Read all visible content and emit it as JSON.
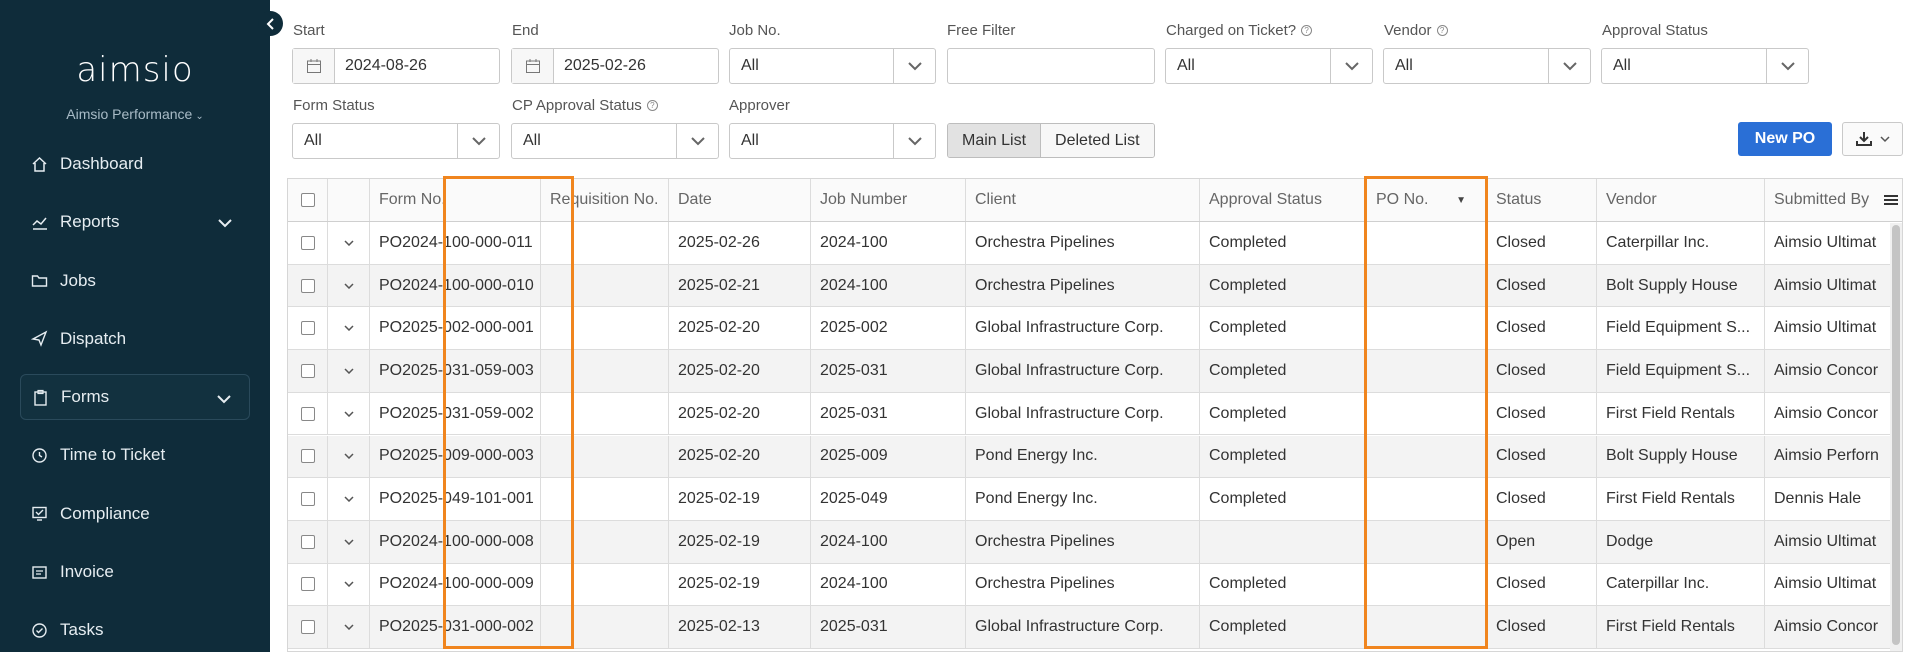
{
  "sidebar": {
    "logo": "aimsio",
    "org_name": "Aimsio Performance",
    "items": [
      {
        "label": "Dashboard",
        "icon": "home-icon",
        "expandable": false,
        "active": false
      },
      {
        "label": "Reports",
        "icon": "chart-icon",
        "expandable": true,
        "active": false
      },
      {
        "label": "Jobs",
        "icon": "folder-icon",
        "expandable": false,
        "active": false
      },
      {
        "label": "Dispatch",
        "icon": "send-icon",
        "expandable": false,
        "active": false
      },
      {
        "label": "Forms",
        "icon": "clipboard-icon",
        "expandable": true,
        "active": true
      },
      {
        "label": "Time to Ticket",
        "icon": "clock-icon",
        "expandable": false,
        "active": false
      },
      {
        "label": "Compliance",
        "icon": "compliance-icon",
        "expandable": false,
        "active": false
      },
      {
        "label": "Invoice",
        "icon": "invoice-icon",
        "expandable": false,
        "active": false
      },
      {
        "label": "Tasks",
        "icon": "check-circle-icon",
        "expandable": false,
        "active": false
      }
    ]
  },
  "filters": {
    "start": {
      "label": "Start",
      "value": "2024-08-26"
    },
    "end": {
      "label": "End",
      "value": "2025-02-26"
    },
    "job_no": {
      "label": "Job No.",
      "value": "All"
    },
    "free_filter": {
      "label": "Free Filter",
      "value": ""
    },
    "charged_on_ticket": {
      "label": "Charged on Ticket?",
      "value": "All"
    },
    "vendor": {
      "label": "Vendor",
      "value": "All"
    },
    "approval_status": {
      "label": "Approval Status",
      "value": "All"
    },
    "form_status": {
      "label": "Form Status",
      "value": "All"
    },
    "cp_approval_status": {
      "label": "CP Approval Status",
      "value": "All"
    },
    "approver": {
      "label": "Approver",
      "value": "All"
    }
  },
  "toolbar": {
    "main_list": "Main List",
    "deleted_list": "Deleted List",
    "new_po": "New PO"
  },
  "table": {
    "columns": [
      "Form No.",
      "Requisition No.",
      "Date",
      "Job Number",
      "Client",
      "Approval Status",
      "PO No.",
      "Status",
      "Vendor",
      "Submitted By"
    ],
    "rows": [
      [
        "PO2024-100-000-011",
        "",
        "2025-02-26",
        "2024-100",
        "Orchestra Pipelines",
        "Completed",
        "",
        "Closed",
        "Caterpillar Inc.",
        "Aimsio Ultimat"
      ],
      [
        "PO2024-100-000-010",
        "",
        "2025-02-21",
        "2024-100",
        "Orchestra Pipelines",
        "Completed",
        "",
        "Closed",
        "Bolt Supply House",
        "Aimsio Ultimat"
      ],
      [
        "PO2025-002-000-001",
        "",
        "2025-02-20",
        "2025-002",
        "Global Infrastructure Corp.",
        "Completed",
        "",
        "Closed",
        "Field Equipment S...",
        "Aimsio Ultimat"
      ],
      [
        "PO2025-031-059-003",
        "",
        "2025-02-20",
        "2025-031",
        "Global Infrastructure Corp.",
        "Completed",
        "",
        "Closed",
        "Field Equipment S...",
        "Aimsio Concor"
      ],
      [
        "PO2025-031-059-002",
        "",
        "2025-02-20",
        "2025-031",
        "Global Infrastructure Corp.",
        "Completed",
        "",
        "Closed",
        "First Field Rentals",
        "Aimsio Concor"
      ],
      [
        "PO2025-009-000-003",
        "",
        "2025-02-20",
        "2025-009",
        "Pond Energy Inc.",
        "Completed",
        "",
        "Closed",
        "Bolt Supply House",
        "Aimsio Perforn"
      ],
      [
        "PO2025-049-101-001",
        "",
        "2025-02-19",
        "2025-049",
        "Pond Energy Inc.",
        "Completed",
        "",
        "Closed",
        "First Field Rentals",
        "Dennis Hale"
      ],
      [
        "PO2024-100-000-008",
        "",
        "2025-02-19",
        "2024-100",
        "Orchestra Pipelines",
        "",
        "",
        "Open",
        "Dodge",
        "Aimsio Ultimat"
      ],
      [
        "PO2024-100-000-009",
        "",
        "2025-02-19",
        "2024-100",
        "Orchestra Pipelines",
        "Completed",
        "",
        "Closed",
        "Caterpillar Inc.",
        "Aimsio Ultimat"
      ],
      [
        "PO2025-031-000-002",
        "",
        "2025-02-13",
        "2025-031",
        "Global Infrastructure Corp.",
        "Completed",
        "",
        "Closed",
        "First Field Rentals",
        "Aimsio Concor"
      ]
    ]
  },
  "colors": {
    "sidebar_bg": "#0f2c3a",
    "primary": "#2a6fd6",
    "highlight": "#f0851e"
  }
}
